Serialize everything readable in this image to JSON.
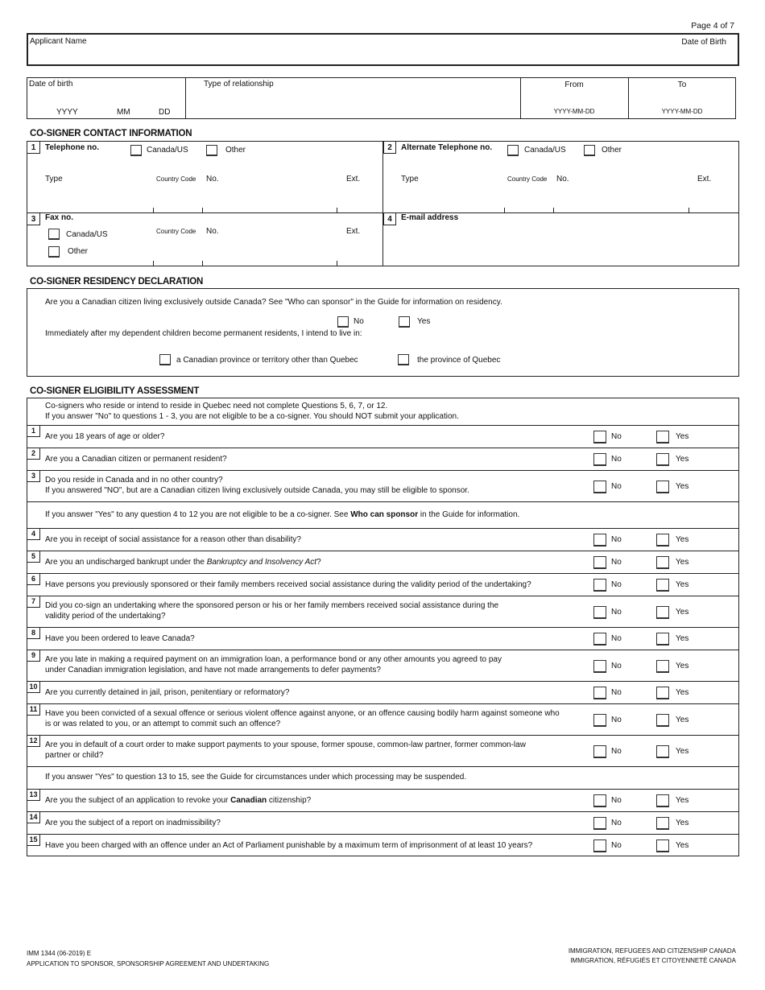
{
  "page_indicator": "Page 4 of 7",
  "applicant_header": {
    "applicant_name_label": "Applicant Name",
    "date_of_birth_label": "Date of Birth"
  },
  "relationship_table": {
    "date_of_birth_label": "Date of birth",
    "yyyy": "YYYY",
    "mm": "MM",
    "dd": "DD",
    "type_of_relationship_label": "Type of relationship",
    "from_label": "From",
    "to_label": "To",
    "from_format": "YYYY-MM-DD",
    "to_format": "YYYY-MM-DD"
  },
  "contact_section": {
    "title": "CO-SIGNER CONTACT INFORMATION",
    "telephone": {
      "number": "1",
      "label": "Telephone no.",
      "option_canada": "Canada/US",
      "option_other": "Other",
      "type_label": "Type",
      "country_code_label": "Country Code",
      "no_label": "No.",
      "ext_label": "Ext."
    },
    "alt_telephone": {
      "number": "2",
      "label": "Alternate Telephone no.",
      "option_canada": "Canada/US",
      "option_other": "Other",
      "type_label": "Type",
      "country_code_label": "Country Code",
      "no_label": "No.",
      "ext_label": "Ext."
    },
    "fax": {
      "number": "3",
      "label": "Fax no.",
      "option_canada": "Canada/US",
      "option_other": "Other",
      "country_code_label": "Country Code",
      "no_label": "No.",
      "ext_label": "Ext."
    },
    "email": {
      "number": "4",
      "label": "E-mail address"
    }
  },
  "residency_section": {
    "title": "CO-SIGNER RESIDENCY DECLARATION",
    "question": "Are you a Canadian citizen living exclusively outside Canada?  See \"Who can sponsor\" in the Guide for information on residency.",
    "no_label": "No",
    "yes_label": "Yes",
    "intent_text": "Immediately after my dependent children become permanent residents, I intend to live in:",
    "option_other_province": "a Canadian province or territory other than Quebec",
    "option_quebec": "the province of Quebec"
  },
  "eligibility_section": {
    "title": "CO-SIGNER ELIGIBILITY ASSESSMENT",
    "intro_line1": "Co-signers who reside or intend to reside in Quebec need not complete Questions 5, 6, 7, or 12.",
    "intro_line2": "If you answer \"No\" to questions 1 - 3, you are not eligible to be a co-signer.  You should NOT submit your application.",
    "note_4_12_pre": "If you answer \"Yes\" to any question 4 to 12 you are not eligible to be a co-signer.  See ",
    "note_4_12_bold": "Who can sponsor",
    "note_4_12_post": " in the Guide for information.",
    "note_13_15": "If you answer \"Yes\" to question 13 to 15, see the Guide for circumstances under which processing may be suspended.",
    "no_label": "No",
    "yes_label": "Yes",
    "questions": [
      {
        "number": "1",
        "text": "Are you 18 years of age or older?"
      },
      {
        "number": "2",
        "text": "Are you a Canadian citizen or permanent resident?"
      },
      {
        "number": "3",
        "text": "Do you reside in Canada and in no other country?",
        "text2": "If you answered \"NO\", but are a Canadian citizen living exclusively outside Canada, you may still be eligible to sponsor."
      },
      {
        "number": "4",
        "text": "Are you in receipt of social assistance for a reason other than disability?"
      },
      {
        "number": "5",
        "text_pre": "Are you an undischarged bankrupt under the  ",
        "text_italic": "Bankruptcy and Insolvency Act",
        "text_post": "?"
      },
      {
        "number": "6",
        "text": "Have persons you previously sponsored or their family members received social assistance during the validity period of the undertaking?"
      },
      {
        "number": "7",
        "text": "Did you co-sign an undertaking where the sponsored person or his or her family members received social assistance during the",
        "text2": "validity period of the undertaking?"
      },
      {
        "number": "8",
        "text": "Have you been ordered to leave Canada?"
      },
      {
        "number": "9",
        "text": "Are you late in making a required payment on an immigration loan, a performance bond or any other amounts you agreed to pay",
        "text2": "under Canadian immigration legislation, and have not made arrangements to defer payments?"
      },
      {
        "number": "10",
        "text": "Are you currently detained in jail, prison, penitentiary or reformatory?"
      },
      {
        "number": "11",
        "text": "Have you been convicted of a sexual offence or serious violent offence against anyone, or an offence causing bodily harm against someone who",
        "text2": "is or was related to you, or an attempt to commit such an offence?"
      },
      {
        "number": "12",
        "text": "Are you in default of a court order to make support payments to your spouse, former spouse, common-law partner,  former common-law",
        "text2": "partner or child?"
      },
      {
        "number": "13",
        "text_pre": "Are you the subject of an application to revoke your ",
        "text_bold": "Canadian",
        "text_post": " citizenship?"
      },
      {
        "number": "14",
        "text": "Are you the subject of a report on inadmissibility?"
      },
      {
        "number": "15",
        "text": "Have you been charged with an offence under an Act of Parliament punishable by a maximum term of imprisonment of at least 10 years?"
      }
    ]
  },
  "footer": {
    "form_code": "IMM 1344 (06-2019) E",
    "form_title": "APPLICATION TO SPONSOR, SPONSORSHIP AGREEMENT AND UNDERTAKING",
    "dept_en": "IMMIGRATION, REFUGEES AND CITIZENSHIP CANADA",
    "dept_fr": "IMMIGRATION, RÉFUGIÉS ET CITOYENNETÉ CANADA"
  }
}
